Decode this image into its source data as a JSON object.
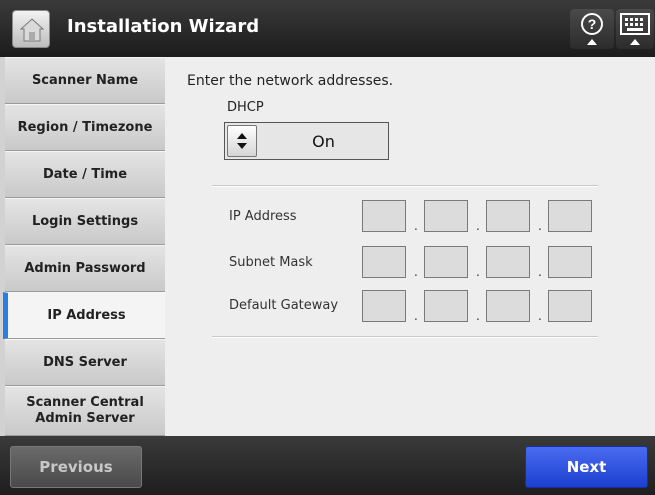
{
  "header": {
    "title": "Installation Wizard",
    "home_icon": "home-icon",
    "help_icon": "help-icon",
    "keyboard_icon": "keyboard-icon"
  },
  "sidebar": {
    "items": [
      {
        "label": "Scanner Name"
      },
      {
        "label": "Region / Timezone"
      },
      {
        "label": "Date / Time"
      },
      {
        "label": "Login Settings"
      },
      {
        "label": "Admin Password"
      },
      {
        "label": "IP Address",
        "active": true
      },
      {
        "label": "DNS Server"
      },
      {
        "label": "Scanner Central Admin Server"
      }
    ],
    "active_color": "#2a7de1"
  },
  "main": {
    "prompt": "Enter the network addresses.",
    "dhcp": {
      "label": "DHCP",
      "value": "On"
    },
    "fields": [
      {
        "label": "IP Address",
        "octets": [
          "",
          "",
          "",
          ""
        ]
      },
      {
        "label": "Subnet Mask",
        "octets": [
          "",
          "",
          "",
          ""
        ]
      },
      {
        "label": "Default Gateway",
        "octets": [
          "",
          "",
          "",
          ""
        ]
      }
    ],
    "separator": "."
  },
  "footer": {
    "previous_label": "Previous",
    "next_label": "Next",
    "next_color": "#2a4fe0"
  }
}
